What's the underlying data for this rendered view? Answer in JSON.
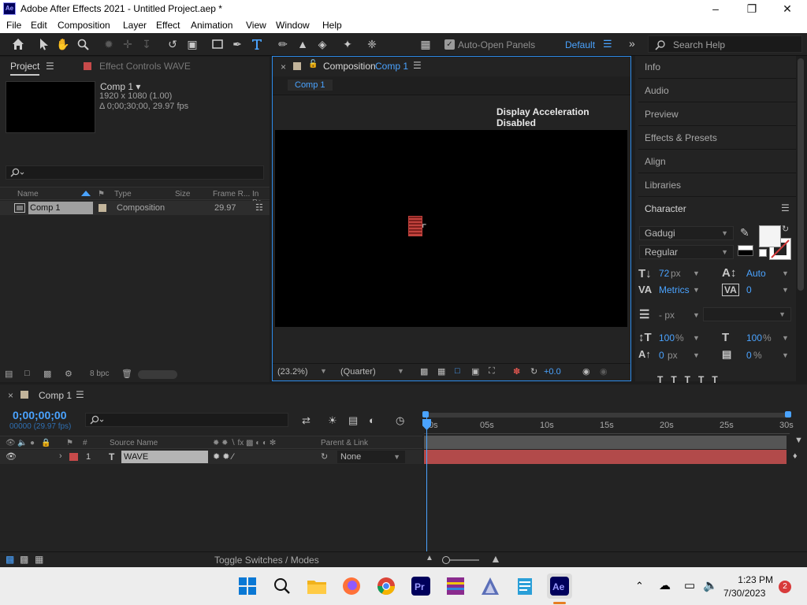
{
  "window": {
    "title": "Adobe After Effects 2021 - Untitled Project.aep *",
    "app_badge": "Ae"
  },
  "menu": [
    "File",
    "Edit",
    "Composition",
    "Layer",
    "Effect",
    "Animation",
    "View",
    "Window",
    "Help"
  ],
  "toolbar": {
    "auto_open_panels": "Auto-Open Panels",
    "workspace": "Default",
    "search_placeholder": "Search Help"
  },
  "project": {
    "tab": "Project",
    "effect_controls": "Effect Controls WAVE",
    "comp_name": "Comp 1 ▾",
    "comp_resolution": "1920 x 1080 (1.00)",
    "comp_duration": "Δ 0;00;30;00, 29.97 fps",
    "columns": [
      "Name",
      "Type",
      "Size",
      "Frame R...",
      "In Po"
    ],
    "items": [
      {
        "name": "Comp 1",
        "type": "Composition",
        "frame_rate": "29.97"
      }
    ],
    "bpc": "8 bpc"
  },
  "composition": {
    "tab_label": "Composition",
    "tab_name": "Comp 1",
    "breadcrumb": "Comp 1",
    "notice": "Display Acceleration Disabled",
    "zoom": "(23.2%)",
    "resolution": "(Quarter)",
    "exposure": "+0.0"
  },
  "right_panels": {
    "items": [
      "Info",
      "Audio",
      "Preview",
      "Effects & Presets",
      "Align",
      "Libraries"
    ],
    "character": {
      "title": "Character",
      "font": "Gadugi",
      "style": "Regular",
      "size": "72",
      "size_unit": "px",
      "leading": "Auto",
      "kerning": "Metrics",
      "tracking": "0",
      "stroke_unit": "- px",
      "vscale": "100",
      "hscale": "100",
      "pct": "%",
      "baseline": "0",
      "baseline_unit": "px",
      "tsume": "0",
      "tsume_unit": "%"
    }
  },
  "timeline": {
    "tab": "Comp 1",
    "timecode": "0;00;00;00",
    "frames": "00000 (29.97 fps)",
    "columns": {
      "source_name": "Source Name",
      "parent": "Parent & Link"
    },
    "layer": {
      "index": "1",
      "name": "WAVE",
      "parent": "None"
    },
    "ticks": [
      "0s",
      "05s",
      "10s",
      "15s",
      "20s",
      "25s",
      "30s"
    ],
    "toggle_label": "Toggle Switches / Modes"
  },
  "taskbar": {
    "time": "1:23 PM",
    "date": "7/30/2023",
    "notifications": "2"
  }
}
